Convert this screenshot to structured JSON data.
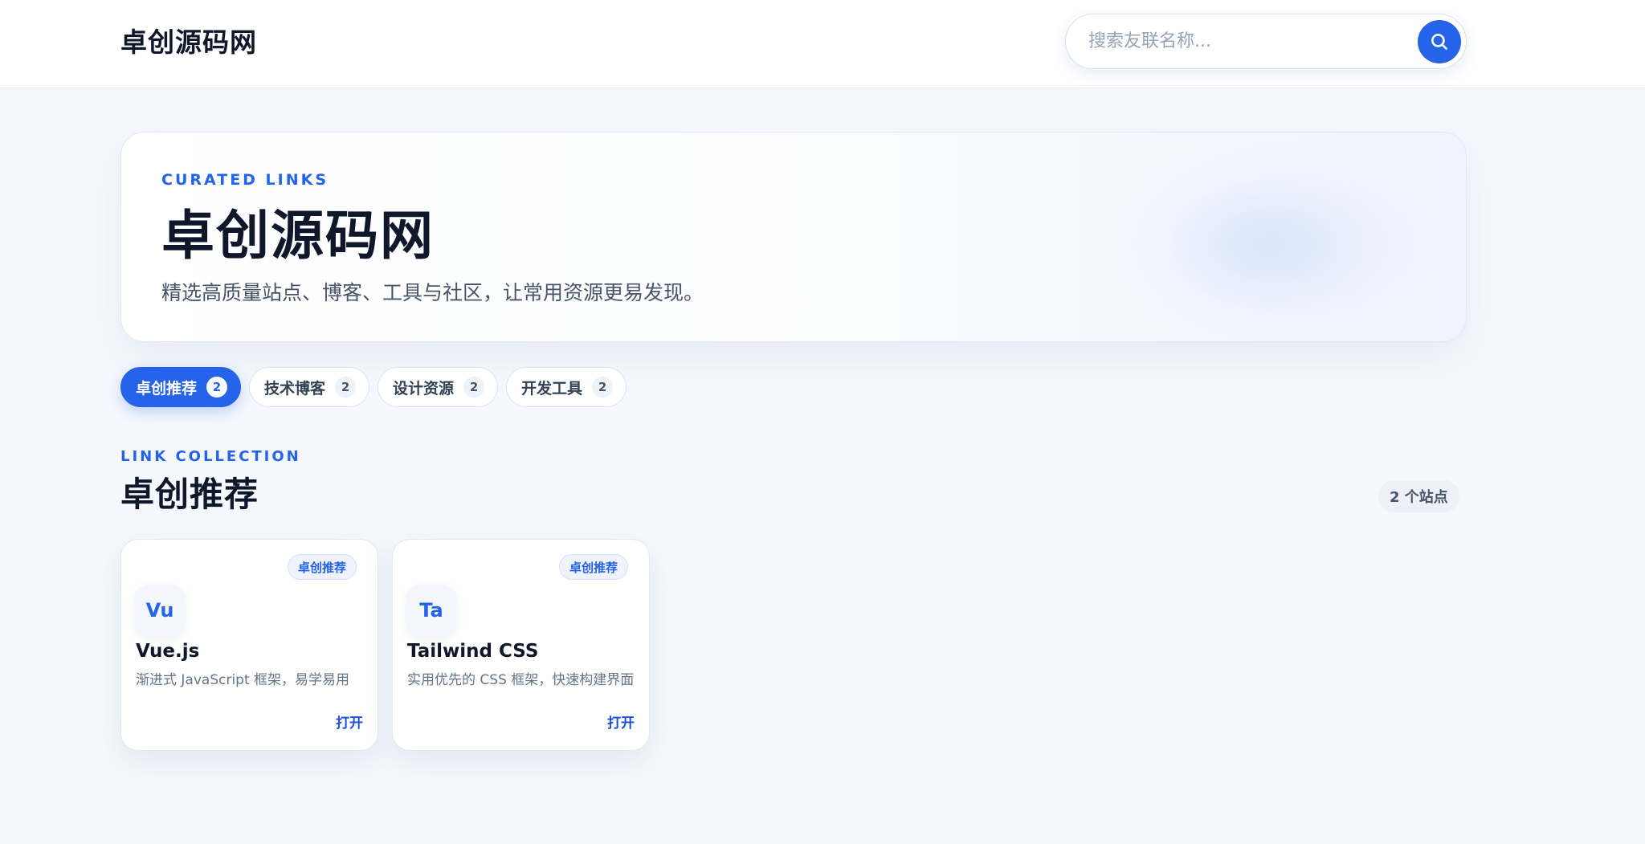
{
  "header": {
    "brand": "卓创源码网",
    "search_placeholder": "搜索友联名称..."
  },
  "hero": {
    "kicker": "CURATED LINKS",
    "title": "卓创源码网",
    "subtitle": "精选高质量站点、博客、工具与社区，让常用资源更易发现。"
  },
  "tabs": [
    {
      "label": "卓创推荐",
      "count": "2",
      "active": true
    },
    {
      "label": "技术博客",
      "count": "2",
      "active": false
    },
    {
      "label": "设计资源",
      "count": "2",
      "active": false
    },
    {
      "label": "开发工具",
      "count": "2",
      "active": false
    }
  ],
  "section": {
    "kicker": "LINK COLLECTION",
    "title": "卓创推荐",
    "count_text": "2 个站点"
  },
  "cards": [
    {
      "badge": "卓创推荐",
      "logo": "Vu",
      "name": "Vue.js",
      "desc": "渐进式 JavaScript 框架，易学易用",
      "open": "打开"
    },
    {
      "badge": "卓创推荐",
      "logo": "Ta",
      "name": "Tailwind CSS",
      "desc": "实用优先的 CSS 框架，快速构建界面",
      "open": "打开"
    }
  ],
  "colors": {
    "accent": "#2563eb",
    "text": "#0f172a",
    "muted": "#64748b",
    "background": "#f5f8fd"
  }
}
